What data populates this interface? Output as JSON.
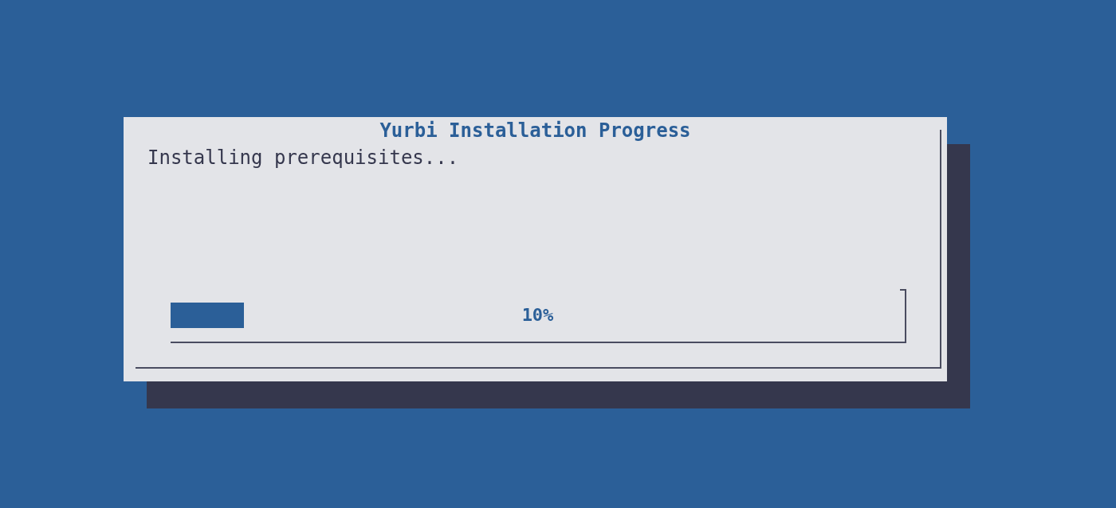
{
  "dialog": {
    "title": "Yurbi Installation Progress",
    "message": "Installing prerequisites...",
    "gauge": {
      "level": 0.1,
      "reading": "10%"
    }
  }
}
